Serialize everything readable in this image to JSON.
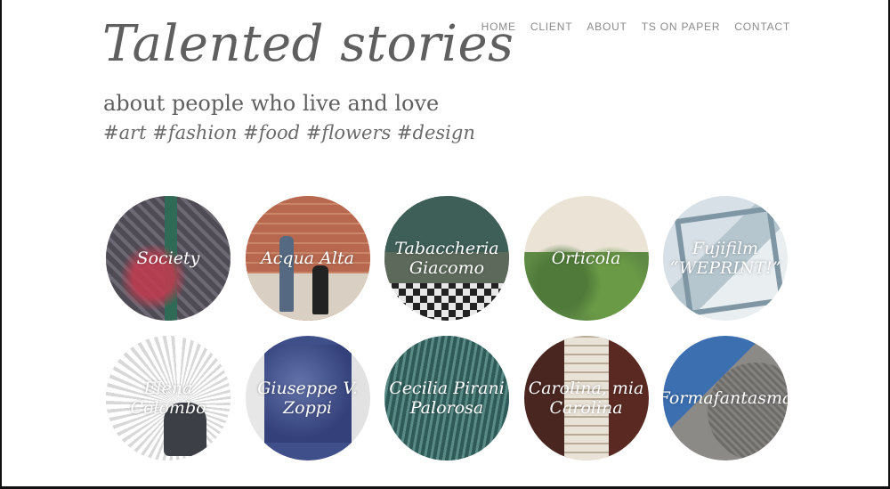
{
  "site": {
    "title": "Talented stories",
    "tagline": "about people who live and love",
    "hashtags": "#art #fashion #food #flowers #design"
  },
  "nav": {
    "items": [
      "HOME",
      "CLIENT",
      "ABOUT",
      "TS ON PAPER",
      "CONTACT"
    ]
  },
  "stories": [
    {
      "label": "Society"
    },
    {
      "label": "Acqua Alta"
    },
    {
      "label": "Tabaccheria\nGiacomo"
    },
    {
      "label": "Orticola"
    },
    {
      "label": "Fujifilm\n“WEPRINT!”"
    },
    {
      "label": "Elena Colombo"
    },
    {
      "label": "Giuseppe V.\nZoppi"
    },
    {
      "label": "Cecilia Pirani\nPalorosa"
    },
    {
      "label": "Carolina, mia\nCarolina"
    },
    {
      "label": "Formafantasma"
    }
  ]
}
